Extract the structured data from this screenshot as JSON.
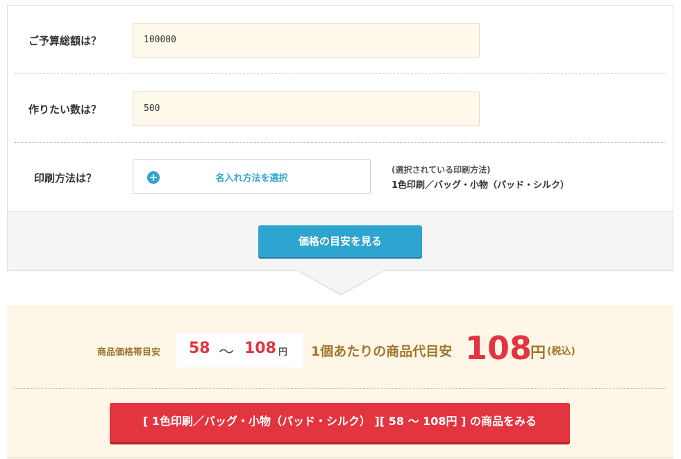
{
  "form": {
    "budget": {
      "label": "ご予算総額は？",
      "value": "100000"
    },
    "quantity": {
      "label": "作りたい数は？",
      "value": "500"
    },
    "print_method": {
      "label": "印刷方法は？",
      "select_button_label": "名入れ方法を選択",
      "select_icon": "plus-circle-icon",
      "selected_caption": "(選択されている印刷方法)",
      "selected_value": "1色印刷／バッグ・小物（パッド・シルク）"
    },
    "estimate_button_label": "価格の目安を見る"
  },
  "result": {
    "range_label": "商品価格帯目安",
    "range_min": "58",
    "range_separator": "〜",
    "range_max": "108",
    "range_unit": "円",
    "per_unit_label": "1個あたりの商品代目安",
    "per_unit_value": "108",
    "per_unit_currency": "円",
    "per_unit_tax_note": "(税込)",
    "products_button_label": "[ 1色印刷／バッグ・小物（パッド・シルク） ][ 58 〜 108円 ] の商品をみる"
  },
  "colors": {
    "accent_blue": "#2ea4d0",
    "accent_red": "#e23540",
    "label_brown": "#a0762c",
    "field_bg": "#fef9ea",
    "result_bg": "#fef7e8"
  }
}
